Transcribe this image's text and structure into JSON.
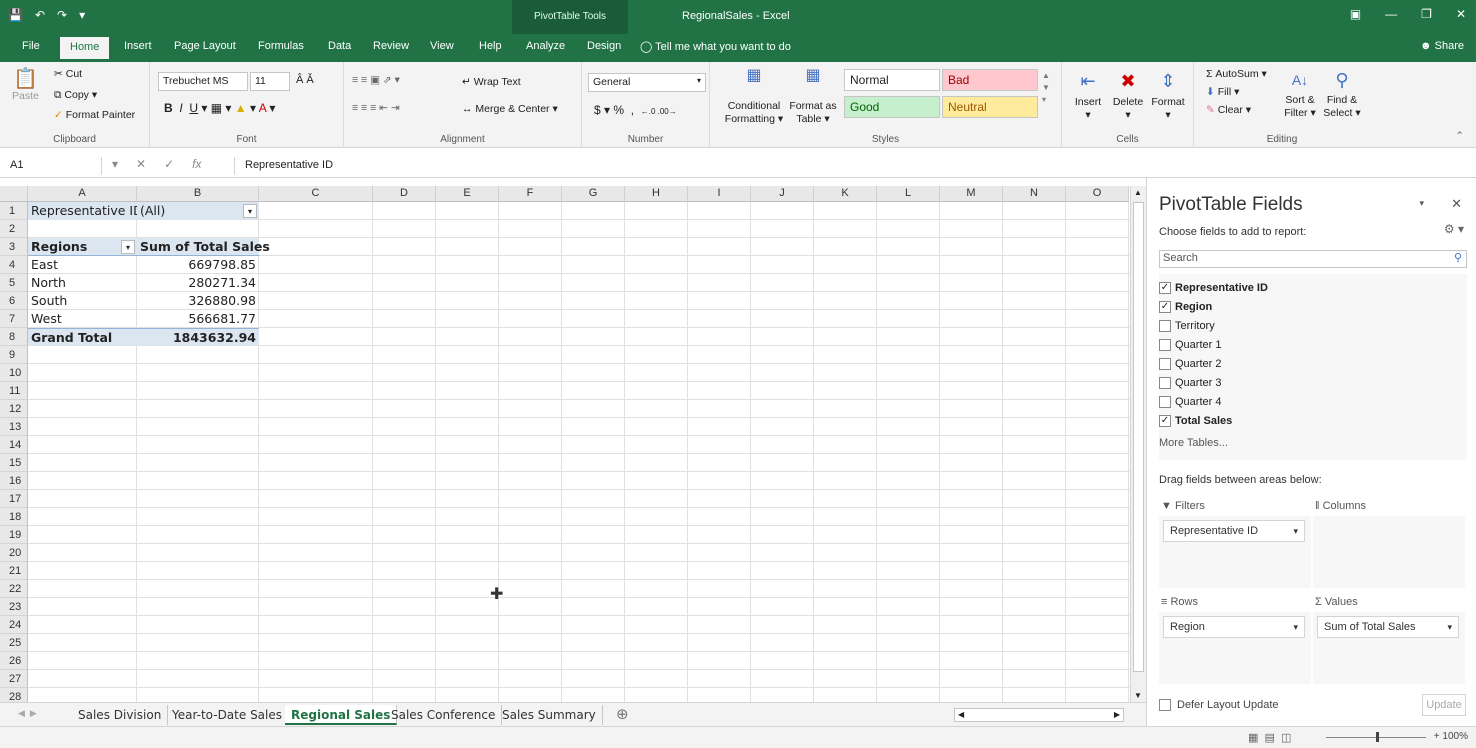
{
  "window": {
    "contextual_tab": "PivotTable Tools",
    "title": "RegionalSales - Excel",
    "share": "Share"
  },
  "tabs": [
    "File",
    "Home",
    "Insert",
    "Page Layout",
    "Formulas",
    "Data",
    "Review",
    "View",
    "Help",
    "Analyze",
    "Design"
  ],
  "tell_me": "Tell me what you want to do",
  "ribbon": {
    "clipboard": {
      "label": "Clipboard",
      "paste": "Paste",
      "cut": "Cut",
      "copy": "Copy",
      "format_painter": "Format Painter"
    },
    "font": {
      "label": "Font",
      "name": "Trebuchet MS",
      "size": "11"
    },
    "alignment": {
      "label": "Alignment",
      "wrap": "Wrap Text",
      "merge": "Merge & Center"
    },
    "number": {
      "label": "Number",
      "format": "General"
    },
    "styles": {
      "label": "Styles",
      "conditional": "Conditional",
      "formatting": "Formatting",
      "format_as": "Format as",
      "table": "Table",
      "normal": "Normal",
      "bad": "Bad",
      "good": "Good",
      "neutral": "Neutral"
    },
    "cells": {
      "label": "Cells",
      "insert": "Insert",
      "delete": "Delete",
      "format": "Format"
    },
    "editing": {
      "label": "Editing",
      "autosum": "AutoSum",
      "fill": "Fill",
      "clear": "Clear",
      "sort": "Sort &",
      "filter": "Filter",
      "find": "Find &",
      "select": "Select"
    }
  },
  "formula_bar": {
    "name_box": "A1",
    "content": "Representative ID"
  },
  "columns": [
    "A",
    "B",
    "C",
    "D",
    "E",
    "F",
    "G",
    "H",
    "I",
    "J",
    "K",
    "L",
    "M",
    "N",
    "O"
  ],
  "rows": [
    "1",
    "2",
    "3",
    "4",
    "5",
    "6",
    "7",
    "8",
    "9",
    "10",
    "11",
    "12",
    "13",
    "14",
    "15",
    "16",
    "17",
    "18",
    "19",
    "20",
    "21",
    "22",
    "23",
    "24",
    "25",
    "26",
    "27",
    "28"
  ],
  "pivot": {
    "filter_label": "Representative ID",
    "filter_value": "(All)",
    "row_header": "Regions",
    "value_header": "Sum of Total Sales",
    "rows": [
      {
        "region": "East",
        "value": "669798.85"
      },
      {
        "region": "North",
        "value": "280271.34"
      },
      {
        "region": "South",
        "value": "326880.98"
      },
      {
        "region": "West",
        "value": "566681.77"
      }
    ],
    "total_label": "Grand Total",
    "total_value": "1843632.94"
  },
  "sheet_tabs": [
    "Sales Division",
    "Year-to-Date Sales",
    "Regional Sales",
    "Sales Conference",
    "Sales Summary"
  ],
  "active_sheet": "Regional Sales",
  "pane": {
    "title": "PivotTable Fields",
    "subtitle": "Choose fields to add to report:",
    "search_placeholder": "Search",
    "fields": [
      {
        "name": "Representative ID",
        "checked": true
      },
      {
        "name": "Region",
        "checked": true
      },
      {
        "name": "Territory",
        "checked": false
      },
      {
        "name": "Quarter 1",
        "checked": false
      },
      {
        "name": "Quarter 2",
        "checked": false
      },
      {
        "name": "Quarter 3",
        "checked": false
      },
      {
        "name": "Quarter 4",
        "checked": false
      },
      {
        "name": "Total Sales",
        "checked": true
      }
    ],
    "more_tables": "More Tables...",
    "drag_label": "Drag fields between areas below:",
    "filters": "Filters",
    "columns": "Columns",
    "rows_area": "Rows",
    "values": "Values",
    "filter_chip": "Representative ID",
    "rows_chip": "Region",
    "values_chip": "Sum of Total Sales",
    "defer": "Defer Layout Update",
    "update": "Update"
  },
  "status": {
    "zoom": "100%"
  },
  "colors": {
    "excel_green": "#217346",
    "bad_bg": "#ffc7ce",
    "good_bg": "#c6efce",
    "neutral_bg": "#ffeb9c",
    "pivot_header": "#dce6f1"
  }
}
